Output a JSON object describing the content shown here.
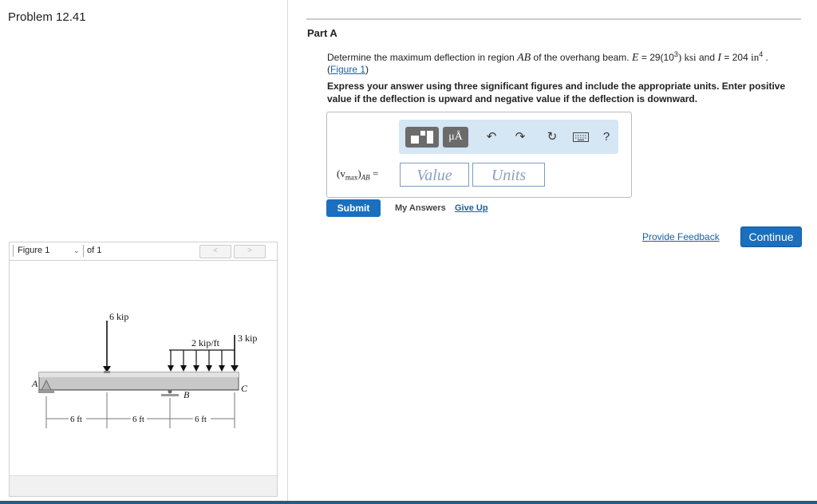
{
  "left": {
    "problem_title": "Problem 12.41",
    "figure": {
      "select_label": "Figure 1",
      "of_label": "of 1",
      "prev_icon": "chevron-left-icon",
      "next_icon": "chevron-right-icon",
      "diagram_labels": {
        "load_6": "6 kip",
        "load_3": "3 kip",
        "dist": "2 kip/ft",
        "A": "A",
        "B": "B",
        "C": "C",
        "d1": "6 ft",
        "d2": "6 ft",
        "d3": "6 ft"
      }
    }
  },
  "part": {
    "title": "Part A",
    "q_pre": "Determine the maximum deflection in region ",
    "q_AB": "AB",
    "q_mid": " of the overhang beam. ",
    "q_E": "E",
    "q_E_val": " = 29(10",
    "q_E_exp": "3",
    "q_E_unit": ") ksi",
    "q_and": " and ",
    "q_I": "I",
    "q_I_val": " = 204 ",
    "q_I_unit": "in",
    "q_I_exp": "4",
    "q_end": " .",
    "figure_link": "Figure 1",
    "instructions": "Express your answer using three significant figures and include the appropriate units. Enter positive value if the deflection is upward and negative value if the deflection is downward.",
    "answer_label_v": "(v",
    "answer_label_sub": "max",
    "answer_label_AB": ")",
    "answer_label_sub2": "AB",
    "answer_label_eq": " =",
    "value_placeholder": "Value",
    "units_placeholder": "Units",
    "unit_btn": "μÅ",
    "help_label": "?",
    "submit": "Submit",
    "my_answers": "My Answers",
    "give_up": "Give Up"
  },
  "footer": {
    "provide_feedback": "Provide Feedback",
    "continue": "Continue"
  },
  "colors": {
    "accent": "#1a6fbe",
    "toolbar_bg": "#d5e6f5",
    "link": "#1a5fa8"
  }
}
